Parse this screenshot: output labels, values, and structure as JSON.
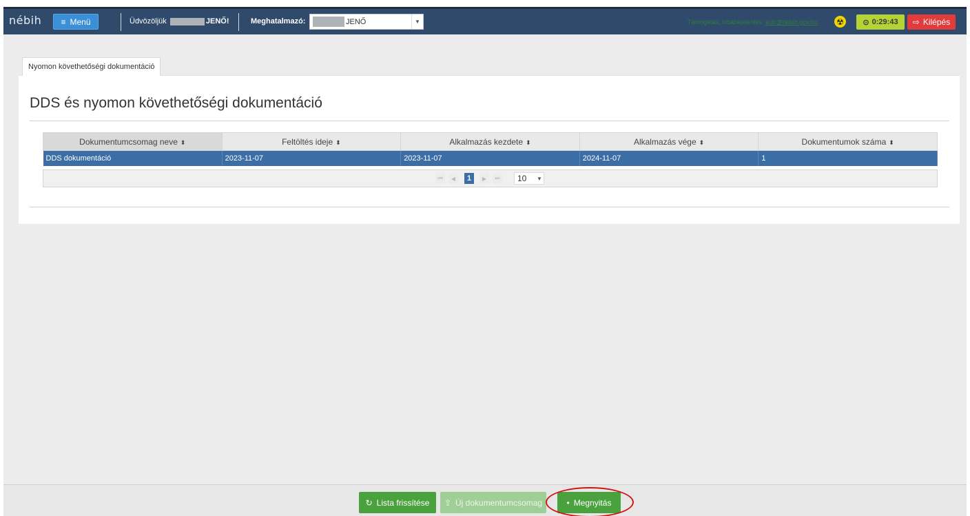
{
  "header": {
    "logo": "nébih",
    "menu_label": "Menü",
    "welcome_prefix": "Üdvözöljük",
    "welcome_name": "JENŐ!",
    "proxy_label": "Meghatalmazó:",
    "proxy_value": "JENŐ",
    "support_text": "Támogatás, hibabejelentés:",
    "support_email": "eutr@nebih.gov.hu",
    "timer": "0:29:43",
    "logout_label": "Kilépés"
  },
  "tab": {
    "label": "Nyomon követhetőségi dokumentáció"
  },
  "page": {
    "title": "DDS és nyomon követhetőségi dokumentáció"
  },
  "table": {
    "columns": [
      "Dokumentumcsomag neve",
      "Feltöltés ideje",
      "Alkalmazás kezdete",
      "Alkalmazás vége",
      "Dokumentumok száma"
    ],
    "rows": [
      [
        "DDS dokumentáció",
        "2023-11-07",
        "2023-11-07",
        "2024-11-07",
        "1"
      ]
    ],
    "row_selected_color": "#3c6ea6"
  },
  "pager": {
    "current_page": "1",
    "page_size": "10"
  },
  "footer": {
    "refresh_label": "Lista frissítése",
    "new_label": "Új dokumentumcsomag",
    "open_label": "Megnyitás"
  },
  "colors": {
    "topbar": "#2f4a6b",
    "primary_green": "#4aa23f",
    "danger_red": "#e23b3b",
    "timer_bg": "#b5d334",
    "highlight_ring": "#d01515"
  },
  "icons": {
    "menu": "hamburger-icon",
    "timer": "clock-icon",
    "logout": "sign-out-icon",
    "refresh": "refresh-icon",
    "new": "upload-icon",
    "open": "eye-icon",
    "radiation": "radiation-icon"
  }
}
